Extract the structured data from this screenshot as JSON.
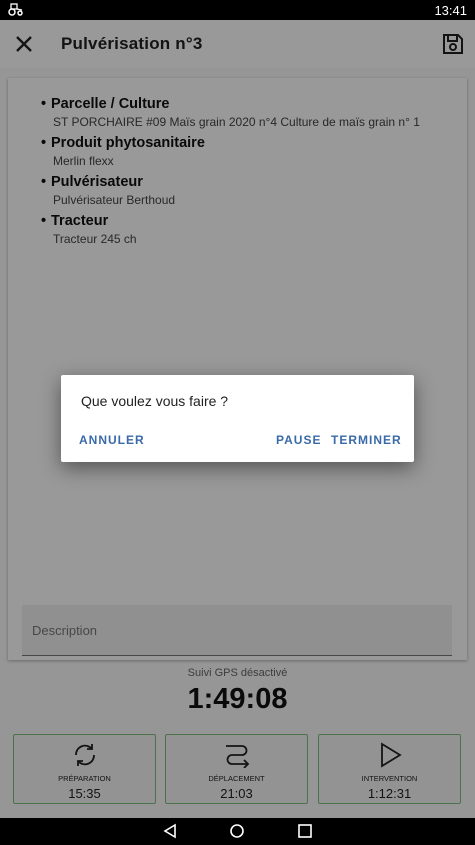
{
  "status": {
    "time": "13:41"
  },
  "appbar": {
    "title": "Pulvérisation n°3"
  },
  "details": [
    {
      "heading": "Parcelle / Culture",
      "value": "ST PORCHAIRE #09 Maïs grain 2020 n°4 Culture de maïs grain n° 1"
    },
    {
      "heading": "Produit phytosanitaire",
      "value": "Merlin flexx"
    },
    {
      "heading": "Pulvérisateur",
      "value": "Pulvérisateur Berthoud"
    },
    {
      "heading": "Tracteur",
      "value": "Tracteur 245 ch"
    }
  ],
  "description": {
    "placeholder": "Description"
  },
  "gps_status": "Suivi GPS désactivé",
  "timer": "1:49:08",
  "phases": [
    {
      "label": "PRÉPARATION",
      "time": "15:35",
      "icon": "refresh-icon"
    },
    {
      "label": "DÉPLACEMENT",
      "time": "21:03",
      "icon": "route-icon"
    },
    {
      "label": "INTERVENTION",
      "time": "1:12:31",
      "icon": "play-icon"
    }
  ],
  "dialog": {
    "message": "Que voulez vous faire ?",
    "cancel_label": "ANNULER",
    "pause_label": "PAUSE",
    "finish_label": "TERMINER"
  },
  "colors": {
    "accent": "#3a6aa8",
    "phase_border": "#7fbf7f"
  }
}
